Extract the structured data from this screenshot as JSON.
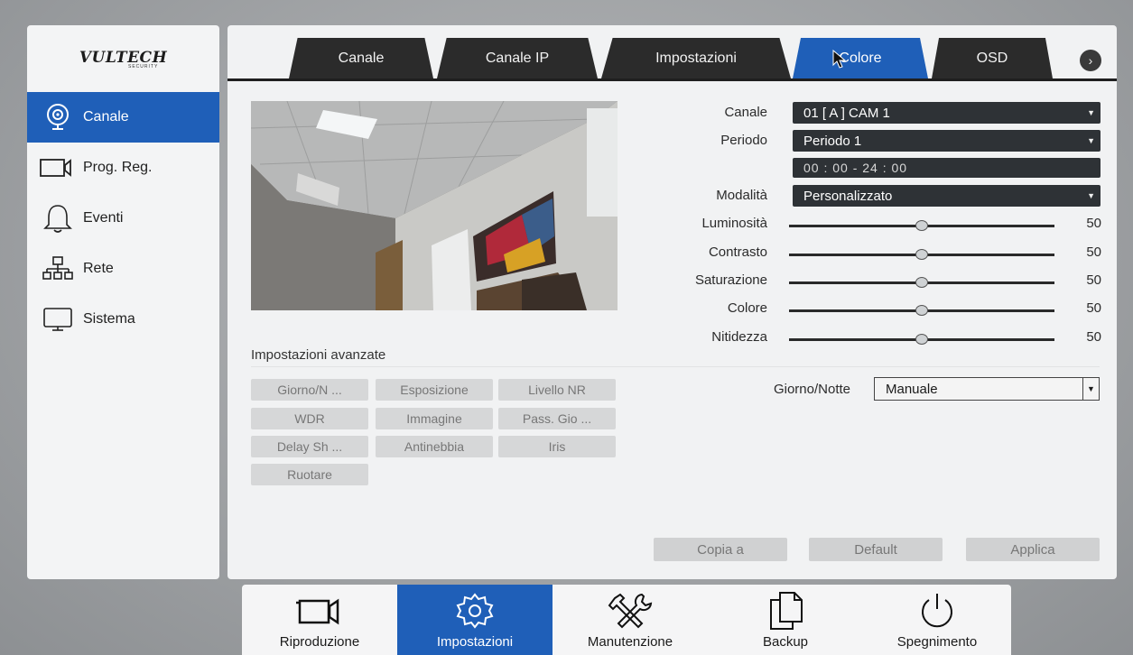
{
  "brand": {
    "logo": "VULTECH",
    "logo_sub": "SECURITY"
  },
  "sidebar": {
    "items": [
      {
        "label": "Canale",
        "icon": "camera-lens-icon",
        "active": true
      },
      {
        "label": "Prog. Reg.",
        "icon": "video-camera-icon",
        "active": false
      },
      {
        "label": "Eventi",
        "icon": "bell-icon",
        "active": false
      },
      {
        "label": "Rete",
        "icon": "network-icon",
        "active": false
      },
      {
        "label": "Sistema",
        "icon": "monitor-icon",
        "active": false
      }
    ]
  },
  "tabs": [
    {
      "label": "Canale",
      "active": false
    },
    {
      "label": "Canale IP",
      "active": false
    },
    {
      "label": "Impostazioni",
      "active": false
    },
    {
      "label": "Colore",
      "active": true
    },
    {
      "label": "OSD",
      "active": false
    }
  ],
  "form": {
    "canale": {
      "label": "Canale",
      "value": "01 [ A ] CAM 1"
    },
    "periodo": {
      "label": "Periodo",
      "value": "Periodo 1"
    },
    "time_range": "00  : 00   -  24   : 00",
    "modalita": {
      "label": "Modalità",
      "value": "Personalizzato"
    },
    "sliders": [
      {
        "label": "Luminosità",
        "value": 50
      },
      {
        "label": "Contrasto",
        "value": 50
      },
      {
        "label": "Saturazione",
        "value": 50
      },
      {
        "label": "Colore",
        "value": 50
      },
      {
        "label": "Nitidezza",
        "value": 50
      }
    ]
  },
  "advanced": {
    "title": "Impostazioni avanzate",
    "buttons": [
      "Giorno/N ...",
      "Esposizione",
      "Livello NR",
      "WDR",
      "Immagine",
      "Pass. Gio ...",
      "Delay Sh ...",
      "Antinebbia",
      "Iris",
      "Ruotare"
    ],
    "day_night": {
      "label": "Giorno/Notte",
      "value": "Manuale"
    }
  },
  "actions": {
    "copy": "Copia a",
    "default": "Default",
    "apply": "Applica"
  },
  "bottom_nav": [
    {
      "label": "Riproduzione",
      "icon": "video-camera-icon",
      "active": false
    },
    {
      "label": "Impostazioni",
      "icon": "gear-icon",
      "active": true
    },
    {
      "label": "Manutenzione",
      "icon": "tools-icon",
      "active": false
    },
    {
      "label": "Backup",
      "icon": "copy-files-icon",
      "active": false
    },
    {
      "label": "Spegnimento",
      "icon": "power-icon",
      "active": false
    }
  ],
  "colors": {
    "accent": "#1f5fb8",
    "dark": "#2e3236",
    "panel": "#f1f2f3"
  }
}
